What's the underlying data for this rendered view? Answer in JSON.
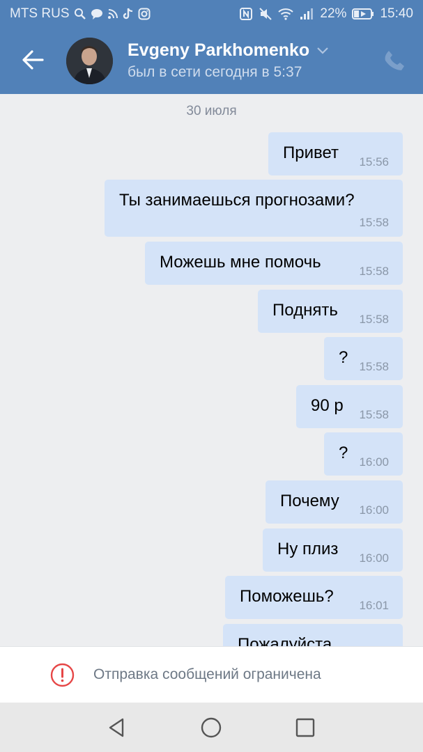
{
  "status": {
    "carrier": "MTS RUS",
    "battery": "22%",
    "time": "15:40",
    "icons": [
      "search-icon",
      "chat-bubble-icon",
      "rss-icon",
      "tiktok-icon",
      "instagram-icon",
      "nfc-icon",
      "mute-icon",
      "wifi-icon",
      "signal-icon",
      "battery-icon"
    ]
  },
  "header": {
    "name": "Evgeny Parkhomenko",
    "subtitle": "был в сети сегодня в 5:37"
  },
  "chat": {
    "date": "30 июля",
    "messages": [
      {
        "text": "Привет",
        "time": "15:56"
      },
      {
        "text": "Ты занимаешься прогнозами?",
        "time": "15:58"
      },
      {
        "text": "Можешь мне помочь",
        "time": "15:58"
      },
      {
        "text": "Поднять",
        "time": "15:58"
      },
      {
        "text": "?",
        "time": "15:58"
      },
      {
        "text": "90 р",
        "time": "15:58"
      },
      {
        "text": "?",
        "time": "16:00"
      },
      {
        "text": "Почему",
        "time": "16:00"
      },
      {
        "text": "Ну плиз",
        "time": "16:00"
      },
      {
        "text": "Поможешь?",
        "time": "16:01"
      },
      {
        "text": "Пожалуйста",
        "time": ""
      }
    ]
  },
  "restriction": {
    "text": "Отправка сообщений ограничена"
  },
  "colors": {
    "header": "#5181b8",
    "bubble": "#d4e3f8",
    "background": "#edeef0",
    "warning": "#e64646"
  }
}
